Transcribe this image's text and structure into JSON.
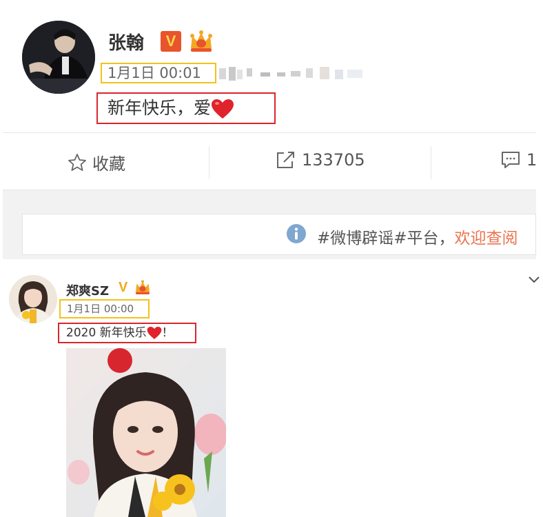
{
  "post1": {
    "author": "张翰",
    "verified_badge": "V",
    "time": "1月1日 00:01",
    "text": "新年快乐，爱",
    "icons": [
      "avatar",
      "verified-v-icon",
      "crown-icon",
      "heart-icon"
    ]
  },
  "actions": {
    "favorite_label": "收藏",
    "repost_count": "133705",
    "comment_count": "1",
    "icons": [
      "star-icon",
      "repost-icon",
      "comment-icon"
    ]
  },
  "notice": {
    "prefix": "#微博辟谣#平台，",
    "link": "欢迎查阅",
    "icon": "info-icon"
  },
  "post2": {
    "author": "郑爽SZ",
    "verified_badge": "V",
    "time": "1月1日 00:00",
    "text_prefix": "2020 新年快乐",
    "text_suffix": "！",
    "icons": [
      "avatar",
      "verified-v-icon",
      "crown-icon",
      "heart-icon",
      "chevron-down-icon"
    ]
  },
  "colors": {
    "highlight_time": "#f2c21a",
    "highlight_text": "#d9262c",
    "heart": "#e0232b",
    "link": "#eb7350",
    "verified_bg": "#e8542b"
  }
}
